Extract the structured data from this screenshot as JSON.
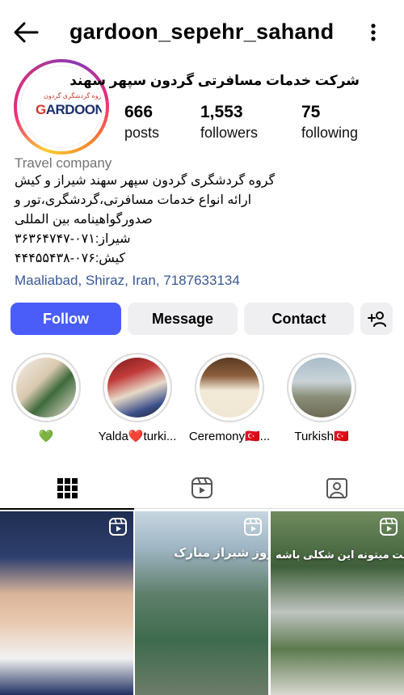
{
  "header": {
    "username": "gardoon_sepehr_sahand",
    "back_icon": "arrow-left-icon",
    "more_icon": "vertical-dots-icon"
  },
  "profile": {
    "business_name": "شرکت خدمات مسافرتی گردون سپهر سهند",
    "avatar_logo_fa": "گروه گردشگری گردون",
    "avatar_logo_en_prefix": "G",
    "avatar_logo_en_rest": "ARDOON",
    "stats": [
      {
        "value": "666",
        "label": "posts"
      },
      {
        "value": "1,553",
        "label": "followers"
      },
      {
        "value": "75",
        "label": "following"
      }
    ],
    "category": "Travel company",
    "bio_lines": [
      "گروه گردشگری گردون سپهر سهند شیراز و کیش",
      "ارائه انواع خدمات مسافرتی،گردشگری،تور و",
      "صدورگواهینامه بین المللی",
      "شیراز:۰۷۱-۳۶۳۶۴۷۴۷",
      "کیش:۰۷۶-۴۴۴۵۵۴۳۸"
    ],
    "address": "Maaliabad, Shiraz, Iran, 7187633134"
  },
  "actions": {
    "follow": "Follow",
    "message": "Message",
    "contact": "Contact",
    "add_user_icon": "add-person-icon"
  },
  "highlights": [
    {
      "label": "💚"
    },
    {
      "label": "Yalda❤️turki..."
    },
    {
      "label": "Ceremony🇹🇷..."
    },
    {
      "label": "Turkish🇹🇷"
    }
  ],
  "tabs": [
    {
      "icon": "grid-icon",
      "active": true
    },
    {
      "icon": "reels-icon",
      "active": false
    },
    {
      "icon": "tagged-icon",
      "active": false
    }
  ],
  "posts": [
    {
      "overlay": "",
      "type": "reel"
    },
    {
      "overlay": "روز شیراز مبارک",
      "type": "reel"
    },
    {
      "overlay": "بهشت میتونه این شکلی باشه",
      "type": "reel"
    }
  ],
  "colors": {
    "follow_button": "#4a5df9",
    "link": "#385898",
    "secondary_button": "#efeff1"
  }
}
